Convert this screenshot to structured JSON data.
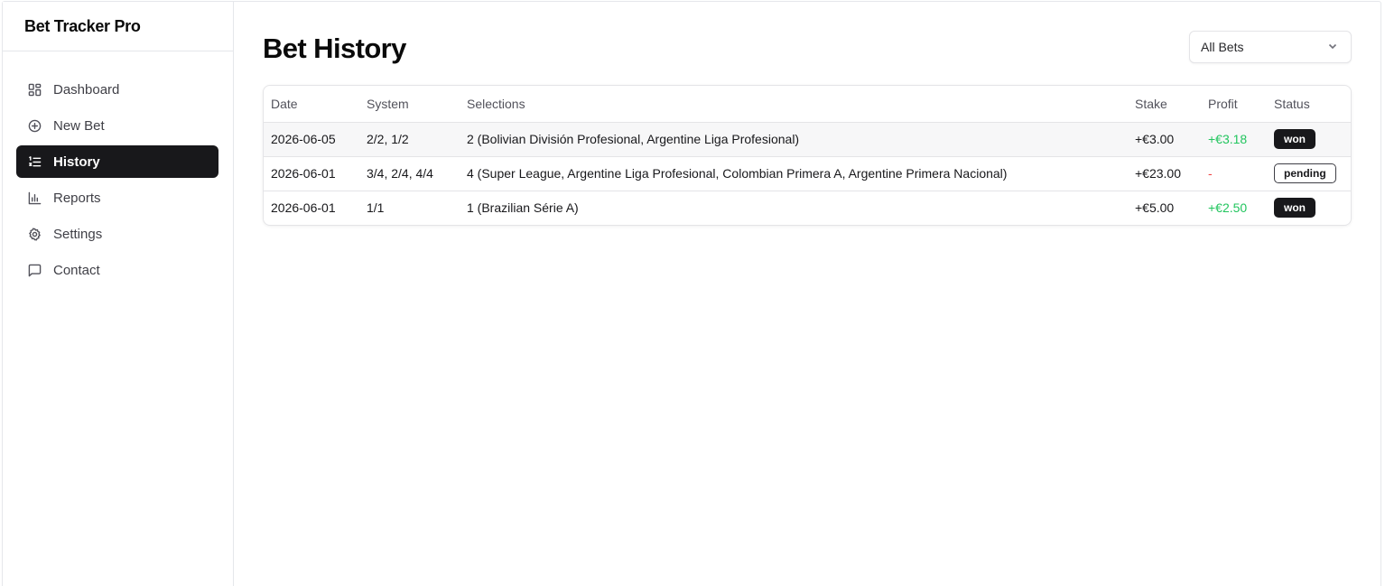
{
  "app": {
    "title": "Bet Tracker Pro"
  },
  "sidebar": {
    "items": [
      {
        "label": "Dashboard",
        "icon": "layout-grid-icon",
        "active": false
      },
      {
        "label": "New Bet",
        "icon": "plus-circle-icon",
        "active": false
      },
      {
        "label": "History",
        "icon": "list-ordered-icon",
        "active": true
      },
      {
        "label": "Reports",
        "icon": "bar-chart-icon",
        "active": false
      },
      {
        "label": "Settings",
        "icon": "gear-icon",
        "active": false
      },
      {
        "label": "Contact",
        "icon": "message-square-icon",
        "active": false
      }
    ]
  },
  "main": {
    "title": "Bet History",
    "filter": {
      "selected": "All Bets"
    },
    "table": {
      "columns": [
        "Date",
        "System",
        "Selections",
        "Stake",
        "Profit",
        "Status"
      ],
      "rows": [
        {
          "date": "2026-06-05",
          "system": "2/2, 1/2",
          "selections": "2 (Bolivian División Profesional, Argentine Liga Profesional)",
          "stake": "+€3.00",
          "profit": "+€3.18",
          "status": "won"
        },
        {
          "date": "2026-06-01",
          "system": "3/4, 2/4, 4/4",
          "selections": "4 (Super League, Argentine Liga Profesional, Colombian Primera A, Argentine Primera Nacional)",
          "stake": "+€23.00",
          "profit": "-",
          "status": "pending"
        },
        {
          "date": "2026-06-01",
          "system": "1/1",
          "selections": "1 (Brazilian Série A)",
          "stake": "+€5.00",
          "profit": "+€2.50",
          "status": "won"
        }
      ]
    }
  },
  "colors": {
    "active_nav": "#18181b",
    "profit_positive": "#22c55e",
    "profit_none": "#ef4444"
  }
}
